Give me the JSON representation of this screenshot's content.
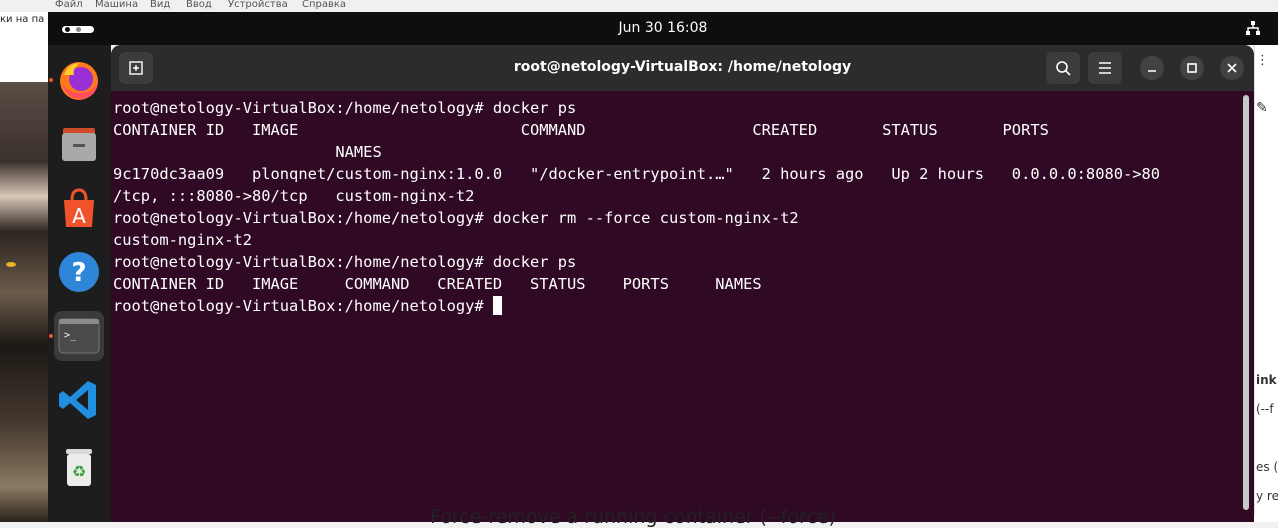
{
  "host_menu": {
    "items": [
      "Файл",
      "Машина",
      "Вид",
      "Ввод",
      "Устройства",
      "Справка"
    ],
    "left_cut_text": "ки на па"
  },
  "topbar": {
    "datetime": "Jun 30  16:08",
    "activities_icon": "activities-dots-icon",
    "network_icon": "network-wired-icon"
  },
  "dock": {
    "items": [
      {
        "name": "Firefox",
        "icon": "firefox-icon"
      },
      {
        "name": "Files",
        "icon": "files-icon"
      },
      {
        "name": "Ubuntu Software",
        "icon": "app-store-icon"
      },
      {
        "name": "Help",
        "icon": "help-icon"
      },
      {
        "name": "Terminal",
        "icon": "terminal-icon"
      },
      {
        "name": "Visual Studio Code",
        "icon": "vscode-icon"
      },
      {
        "name": "Trash",
        "icon": "trash-icon"
      }
    ]
  },
  "terminal": {
    "title": "root@netology-VirtualBox: /home/netology",
    "lines": [
      "root@netology-VirtualBox:/home/netology# docker ps",
      "CONTAINER ID   IMAGE                        COMMAND                  CREATED       STATUS       PORTS",
      "                        NAMES",
      "9c170dc3aa09   plonqnet/custom-nginx:1.0.0   \"/docker-entrypoint.…\"   2 hours ago   Up 2 hours   0.0.0.0:8080->80",
      "/tcp, :::8080->80/tcp   custom-nginx-t2",
      "root@netology-VirtualBox:/home/netology# docker rm --force custom-nginx-t2",
      "custom-nginx-t2",
      "root@netology-VirtualBox:/home/netology# docker ps",
      "CONTAINER ID   IMAGE     COMMAND   CREATED   STATUS    PORTS     NAMES"
    ],
    "prompt": "root@netology-VirtualBox:/home/netology# ",
    "colors": {
      "background": "#300a24",
      "header": "#2c2c2c",
      "text": "#ffffff"
    }
  },
  "host_right": {
    "snippets": [
      "ink",
      "(--f",
      "es (-",
      "y rer"
    ]
  },
  "bottom_text": "Force-remove a running container (--force)"
}
